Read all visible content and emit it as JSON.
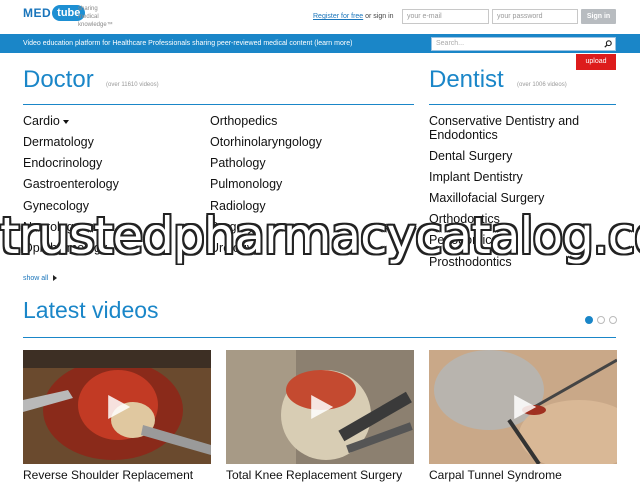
{
  "header": {
    "logo_med": "MED",
    "logo_tube": "tube",
    "tagline": [
      "sharing",
      "medical",
      "knowledge™"
    ],
    "register_link": "Register for free",
    "or_sign_in": "or sign in",
    "email_placeholder": "your e-mail",
    "password_placeholder": "your password",
    "sign_in_button": "Sign in"
  },
  "bluebar": {
    "text": "Video education platform for Healthcare Professionals sharing peer-reviewed medical content (learn more)",
    "search_placeholder": "Search...",
    "upload_button": "upload"
  },
  "doctor": {
    "title": "Doctor",
    "subtitle": "(over 11610 videos)",
    "col1": [
      "Cardio",
      "Dermatology",
      "Endocrinology",
      "Gastroenterology",
      "Gynecology",
      "Neurology",
      "Ophthalmology"
    ],
    "col2": [
      "Orthopedics",
      "Otorhinolaryngology",
      "Pathology",
      "Pulmonology",
      "Radiology",
      "Surgery",
      "Urology"
    ]
  },
  "dentist": {
    "title": "Dentist",
    "subtitle": "(over 1006 videos)",
    "items": [
      "Conservative Dentistry and",
      "Endodontics",
      "Dental Surgery",
      "Implant Dentistry",
      "Maxillofacial Surgery",
      "Orthodontics",
      "Periodontics",
      "Prosthodontics"
    ]
  },
  "show_all": "show all",
  "latest": {
    "title": "Latest videos",
    "videos": [
      {
        "title": "Reverse Shoulder Replacement"
      },
      {
        "title": "Total Knee Replacement Surgery"
      },
      {
        "title": "Carpal Tunnel Syndrome"
      }
    ]
  },
  "watermark": "trustedpharmacycatalog.com",
  "colors": {
    "brand_blue": "#1a86c8",
    "upload_red": "#dd1c1c"
  }
}
